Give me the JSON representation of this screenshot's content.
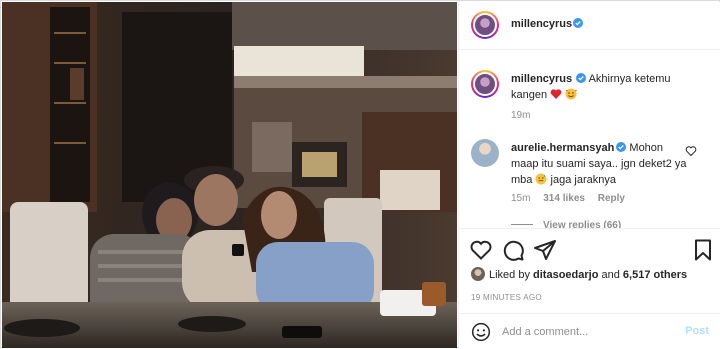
{
  "photo": {
    "alt_icon": "photo-of-four-people-at-table"
  },
  "header": {
    "username": "millencyrus",
    "verified_icon": "verified-badge-icon"
  },
  "caption": {
    "username": "millencyrus",
    "text": "Akhirnya ketemu kangen",
    "emojis": [
      "red-heart-emoji",
      "smiling-face-with-hearts-emoji"
    ],
    "time": "19m"
  },
  "comment": {
    "username": "aurelie.hermansyah",
    "text_part1": "Mohon maap itu suami saya.. jgn deket2 ya mba",
    "text_part2": "jaga jaraknya",
    "emoji": "sweat-emoji",
    "time": "15m",
    "likes": "314 likes",
    "reply": "Reply",
    "view_replies": "View replies (66)"
  },
  "actions": {
    "likes_prefix": "Liked by ",
    "liked_by_user": "ditasoedarjo",
    "likes_join": " and ",
    "likes_count": "6,517 others",
    "date": "19 MINUTES AGO"
  },
  "add_comment": {
    "placeholder": "Add a comment...",
    "post_label": "Post"
  },
  "colors": {
    "accent": "#0095f6",
    "post_disabled": "#b2dffc",
    "heart": "#ed4956",
    "meta": "#8e8e8e"
  }
}
